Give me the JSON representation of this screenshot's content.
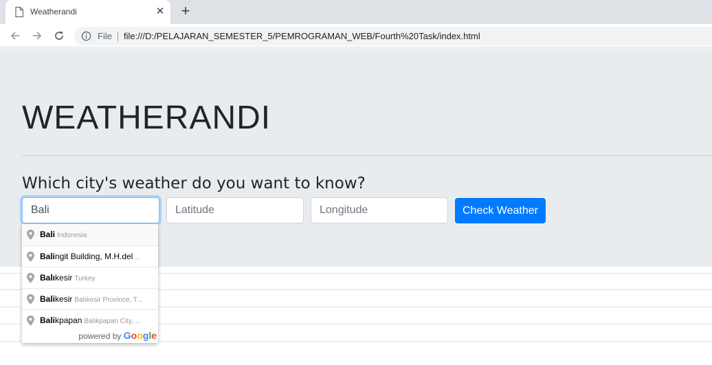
{
  "browser": {
    "tab_title": "Weatherandi",
    "close_glyph": "✕",
    "newtab_glyph": "+",
    "file_label": "File",
    "url": "file:///D:/PELAJARAN_SEMESTER_5/PEMROGRAMAN_WEB/Fourth%20Task/index.html"
  },
  "page": {
    "brand": "WEATHERANDI",
    "question": "Which city's weather do you want to know?",
    "city_value": "Bali",
    "latitude_placeholder": "Latitude",
    "longitude_placeholder": "Longitude",
    "submit_label": "Check Weather"
  },
  "autocomplete": {
    "items": [
      {
        "match": "Bali",
        "rest": "",
        "secondary": "Indonesia",
        "ellipsis": ""
      },
      {
        "match": "Bali",
        "rest": "ngit Building, M.H.del",
        "secondary": "",
        "ellipsis": "..."
      },
      {
        "match": "Balı",
        "rest": "kesir",
        "secondary": "Turkey",
        "ellipsis": ""
      },
      {
        "match": "Bali",
        "rest": "kesir",
        "secondary": "Balıkesir Province, T...",
        "ellipsis": ""
      },
      {
        "match": "Bali",
        "rest": "kpapan",
        "secondary": "Balikpapan City, ...",
        "ellipsis": ""
      }
    ],
    "powered_by": "powered by",
    "google": "Google"
  },
  "icons": {
    "page": "page-icon",
    "back": "arrow-left-icon",
    "forward": "arrow-right-icon",
    "reload": "reload-icon",
    "info": "info-icon",
    "pin": "map-pin-icon"
  },
  "colors": {
    "primary": "#007bff",
    "jumbotron": "#e9ecef",
    "google_blue": "#4285F4",
    "google_red": "#EA4335",
    "google_yellow": "#FBBC05",
    "google_green": "#34A853"
  }
}
